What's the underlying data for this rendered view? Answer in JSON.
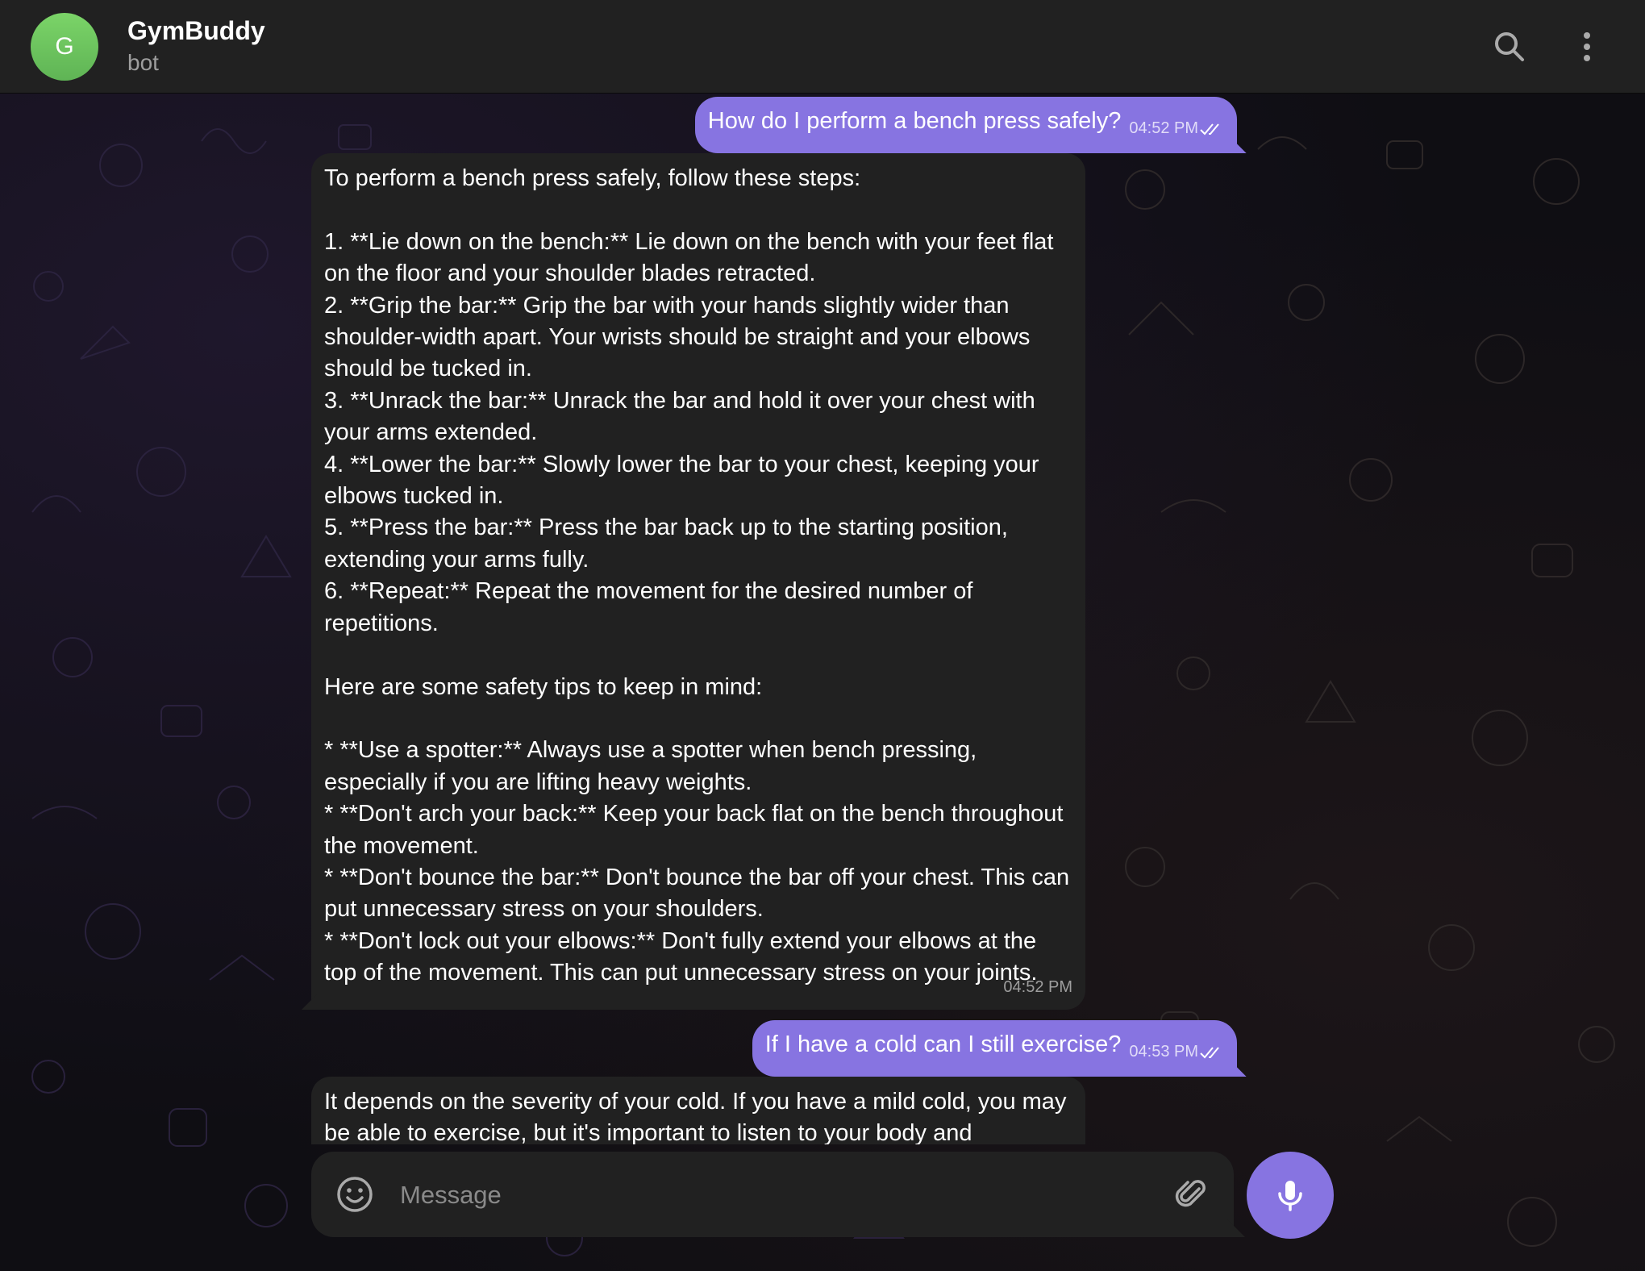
{
  "header": {
    "avatar_letter": "G",
    "title": "GymBuddy",
    "subtitle": "bot",
    "icons": [
      "search-icon",
      "more-vertical-icon"
    ]
  },
  "messages": [
    {
      "direction": "outgoing",
      "text": "How do I perform a bench press safely?",
      "time": "04:52 PM",
      "status": "read"
    },
    {
      "direction": "incoming",
      "text": "To perform a bench press safely, follow these steps:\n\n1. **Lie down on the bench:** Lie down on the bench with your feet flat on the floor and your shoulder blades retracted.\n2. **Grip the bar:** Grip the bar with your hands slightly wider than shoulder-width apart. Your wrists should be straight and your elbows should be tucked in.\n3. **Unrack the bar:** Unrack the bar and hold it over your chest with your arms extended.\n4. **Lower the bar:** Slowly lower the bar to your chest, keeping your elbows tucked in.\n5. **Press the bar:** Press the bar back up to the starting position, extending your arms fully.\n6. **Repeat:** Repeat the movement for the desired number of repetitions.\n\nHere are some safety tips to keep in mind:\n\n* **Use a spotter:** Always use a spotter when bench pressing, especially if you are lifting heavy weights.\n* **Don't arch your back:** Keep your back flat on the bench throughout the movement.\n* **Don't bounce the bar:** Don't bounce the bar off your chest. This can put unnecessary stress on your shoulders.\n* **Don't lock out your elbows:** Don't fully extend your elbows at the top of the movement. This can put unnecessary stress on your joints.",
      "time": "04:52 PM"
    },
    {
      "direction": "outgoing",
      "text": "If I have a cold can I still exercise?",
      "time": "04:53 PM",
      "status": "read"
    },
    {
      "direction": "incoming",
      "text": "It depends on the severity of your cold. If you have a mild cold, you may be able to exercise, but it's important to listen to your body and"
    }
  ],
  "composer": {
    "placeholder": "Message",
    "value": "",
    "icons": [
      "emoji-icon",
      "attach-icon",
      "microphone-icon"
    ]
  },
  "colors": {
    "accent": "#8774e1",
    "header_bg": "#212121",
    "incoming_bubble": "#212121",
    "avatar": "#6cc45e",
    "background": "#0f0e13"
  }
}
